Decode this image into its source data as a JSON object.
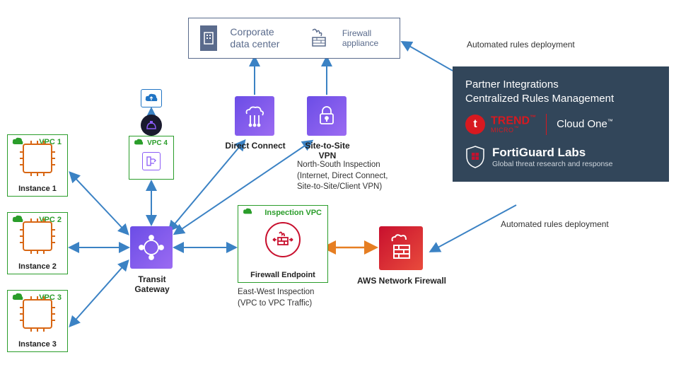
{
  "vpcs": [
    {
      "name": "VPC 1",
      "instance": "Instance 1"
    },
    {
      "name": "VPC 2",
      "instance": "Instance 2"
    },
    {
      "name": "VPC 3",
      "instance": "Instance 3"
    },
    {
      "name": "VPC 4",
      "instance": ""
    }
  ],
  "inspection_vpc": {
    "name": "Inspection VPC",
    "endpoint_label": "Firewall Endpoint"
  },
  "transit_gateway": {
    "label": "Transit Gateway"
  },
  "direct_connect": {
    "label": "Direct Connect"
  },
  "site_to_site_vpn": {
    "label": "Site-to-Site VPN"
  },
  "corporate": {
    "title": "Corporate data center",
    "firewall": "Firewall appliance"
  },
  "north_south": {
    "line1": "North-South Inspection",
    "line2": "(Internet, Direct Connect,",
    "line3": "Site-to-Site/Client VPN)"
  },
  "east_west": {
    "line1": "East-West Inspection",
    "line2": "(VPC to VPC Traffic)"
  },
  "aws_fw": {
    "label": "AWS Network Firewall"
  },
  "partner": {
    "title1": "Partner Integrations",
    "title2": "Centralized Rules Management",
    "trend_brand": "TREND",
    "trend_sub": "MICRO",
    "cloud_one": "Cloud One",
    "forti": "FortiGuard Labs",
    "forti_sub": "Global threat research and response"
  },
  "notes": {
    "rules_top": "Automated rules deployment",
    "rules_bottom": "Automated rules deployment"
  }
}
